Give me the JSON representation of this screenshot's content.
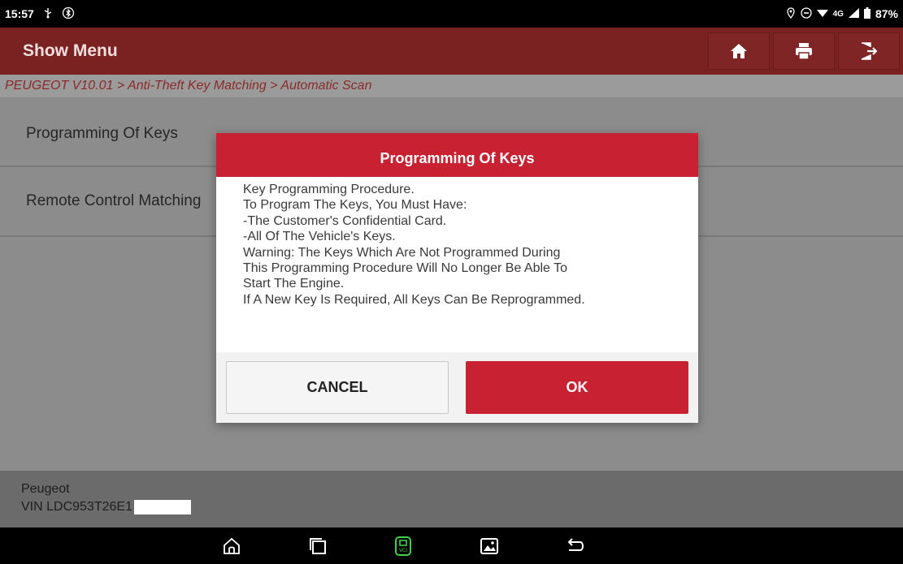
{
  "status_bar": {
    "time": "15:57",
    "network": "4G",
    "battery": "87%"
  },
  "header": {
    "title": "Show Menu"
  },
  "breadcrumb": "PEUGEOT V10.01 > Anti-Theft Key Matching > Automatic Scan",
  "menu": {
    "items": [
      {
        "label": "Programming Of Keys"
      },
      {
        "label": "Remote Control Matching"
      }
    ]
  },
  "dialog": {
    "title": "Programming Of Keys",
    "lines": [
      "Key Programming Procedure.",
      "To Program The Keys, You Must Have:",
      " -The Customer's Confidential Card.",
      " -All Of The Vehicle's Keys.",
      "Warning: The Keys Which Are Not Programmed During",
      "This Programming Procedure Will No Longer Be Able To",
      "Start The Engine.",
      "If A New Key Is Required, All Keys Can Be Reprogrammed."
    ],
    "cancel_label": "CANCEL",
    "ok_label": "OK"
  },
  "vehicle": {
    "make": "Peugeot",
    "vin": "VIN LDC953T26E1"
  },
  "colors": {
    "accent": "#c82131",
    "title_bar": "#7a2121",
    "vci_icon": "#3bd14a"
  }
}
